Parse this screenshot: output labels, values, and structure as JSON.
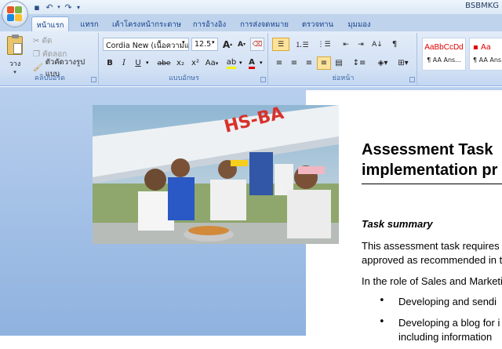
{
  "window": {
    "title": "BSBMKG"
  },
  "tabs": [
    {
      "label": "หน้าแรก",
      "active": true
    },
    {
      "label": "แทรก"
    },
    {
      "label": "เค้าโครงหน้ากระดาษ"
    },
    {
      "label": "การอ้างอิง"
    },
    {
      "label": "การส่งจดหมาย"
    },
    {
      "label": "ตรวจทาน"
    },
    {
      "label": "มุมมอง"
    }
  ],
  "clipboard": {
    "paste_label": "วาง",
    "cut_label": "ตัด",
    "copy_label": "คัดลอก",
    "format_painter_label": "ตัวคัดวางรูปแบบ",
    "group_label": "คลิปบอร์ด"
  },
  "font": {
    "family": "Cordia New (เนื้อความแบบ",
    "size": "12.5",
    "group_label": "แบบอักษร",
    "grow": "A",
    "shrink": "A",
    "bold": "B",
    "italic": "I",
    "underline": "U",
    "strike": "abe",
    "subscript": "x₂",
    "superscript": "x²",
    "change_case": "Aa",
    "font_color": "A"
  },
  "paragraph": {
    "group_label": "ย่อหน้า"
  },
  "styles": [
    {
      "sample": "AaBbCcDd",
      "name": "¶ AA Ans..."
    },
    {
      "sample": "Aa",
      "name": "¶ AA Ans..."
    }
  ],
  "document": {
    "heading_line1": "Assessment Task",
    "heading_line2": "implementation pr",
    "section_title": "Task summary",
    "para1_line1": "This assessment task requires",
    "para1_line2": "approved as recommended in t",
    "para2": "In the role of Sales and Marketi",
    "bullet1": "Developing and sendi",
    "bullet2_line1": "Developing a blog for i",
    "bullet2_line2": "including information"
  },
  "colors": {
    "accent": "#15428b",
    "ribbon": "#d2e1f4",
    "doc_bg": "#8fb2df"
  }
}
